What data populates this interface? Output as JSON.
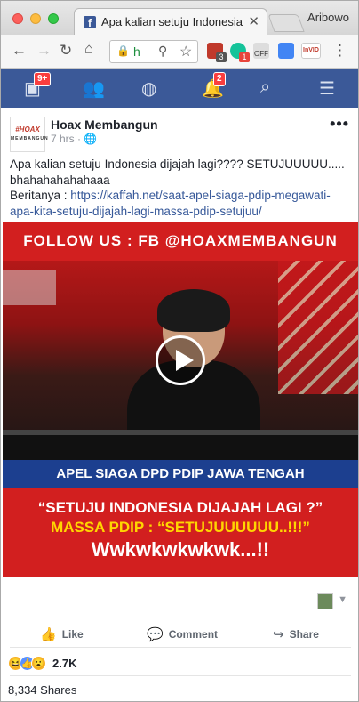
{
  "browser": {
    "tab_title": "Apa kalian setuju Indonesia d",
    "tab_close": "✕",
    "profile_name": "Aribowo",
    "url": "h",
    "extensions": [
      {
        "name": "ublock-extension",
        "badge": "3",
        "color": "#c0392b",
        "badge_color": "#555"
      },
      {
        "name": "grammarly-extension",
        "badge": "1",
        "color": "#15c39a",
        "badge_color": "#e8453c"
      },
      {
        "name": "off-extension",
        "badge": "OFF",
        "color": "#888",
        "badge_color": ""
      },
      {
        "name": "translate-extension",
        "badge": "",
        "color": "#4285f4",
        "badge_color": ""
      },
      {
        "name": "invid-extension",
        "badge": "InVID",
        "color": "#fff",
        "badge_color": ""
      }
    ]
  },
  "fbnav": {
    "home_badge": "9+",
    "notifications_badge": "2"
  },
  "post": {
    "page_name": "Hoax Membangun",
    "avatar_text": "#HOAX",
    "avatar_sub": "MEMBANGUN",
    "time": "7 hrs · ",
    "more": "•••",
    "text_line": "Apa kalian setuju Indonesia dijajah lagi???? SETUJUUUUU..... bhahahahahahaaa",
    "source_prefix": "Beritanya : ",
    "source_link": "https://kaffah.net/saat-apel-siaga-pdip-megawati-apa-kita-setuju-dijajah-lagi-massa-pdip-setujuu/"
  },
  "video": {
    "banner_top": "FOLLOW US : FB @HOAXMEMBANGUN",
    "caption_bar": "APEL SIAGA DPD PDIP JAWA TENGAH",
    "line1": "“SETUJU INDONESIA DIJAJAH LAGI ?”",
    "line2": "MASSA PDIP : “SETUJUUUUUU..!!!”",
    "line3": "Wwkwkwkwkwk...!!"
  },
  "actions": {
    "like": "Like",
    "comment": "Comment",
    "share": "Share"
  },
  "stats": {
    "reactions_count": "2.7K",
    "shares": "8,334 Shares"
  },
  "colors": {
    "fb_blue": "#3b5998",
    "banner_red": "#d21f1f",
    "caption_blue": "#1c3f8f",
    "link": "#365899"
  }
}
